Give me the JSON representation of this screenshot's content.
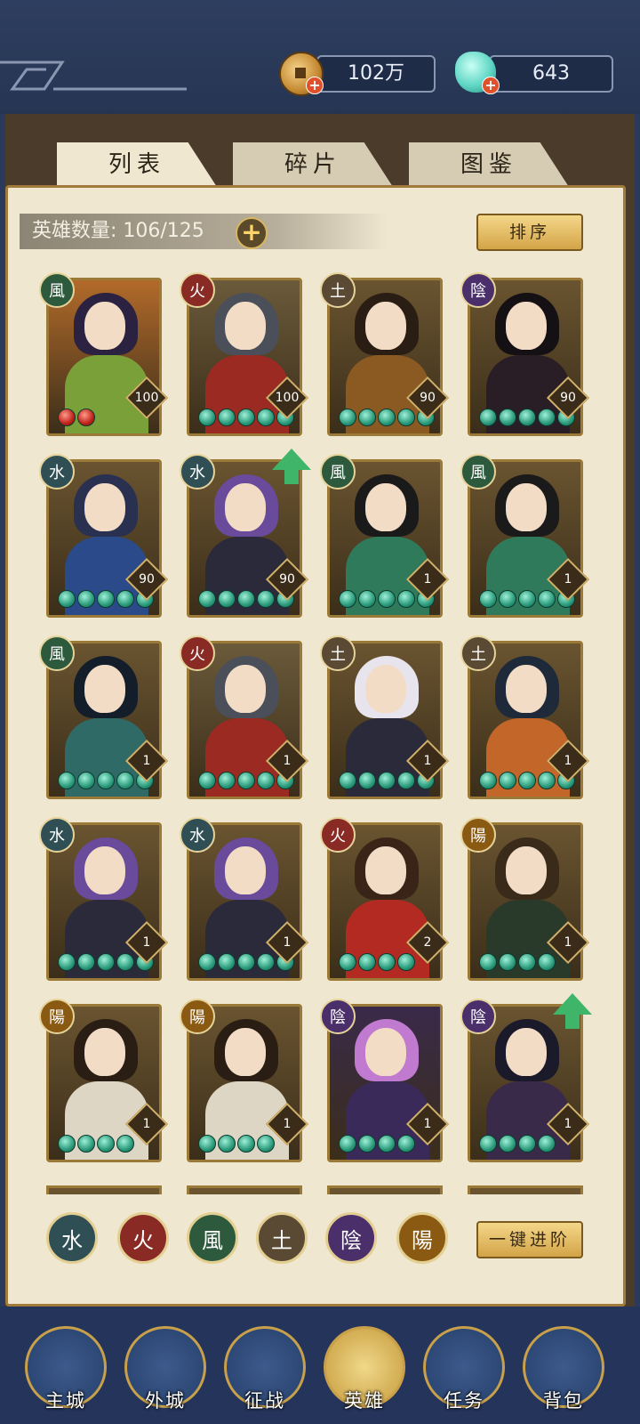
{
  "header": {
    "coins": {
      "value": "102万",
      "icon": "copper-coin-icon"
    },
    "jade": {
      "value": "643",
      "icon": "jade-pouch-icon"
    }
  },
  "tabs": [
    {
      "label": "列表",
      "active": true
    },
    {
      "label": "碎片",
      "active": false
    },
    {
      "label": "图鉴",
      "active": false
    }
  ],
  "hero_count": {
    "label": "英雄数量: 106/125"
  },
  "sort_button": "排序",
  "advance_button": "一键进阶",
  "elements": {
    "water": {
      "glyph": "水",
      "color": "#2f4f55"
    },
    "fire": {
      "glyph": "火",
      "color": "#8a2a24"
    },
    "wind": {
      "glyph": "風",
      "color": "#2d5a3c"
    },
    "earth": {
      "glyph": "土",
      "color": "#5a4a34"
    },
    "yin": {
      "glyph": "陰",
      "color": "#4a2f6a"
    },
    "yang": {
      "glyph": "陽",
      "color": "#8a5a12"
    }
  },
  "heroes": [
    {
      "element": "wind",
      "level": "100",
      "beads": 2,
      "bead_color": "red",
      "bg": "#b26a2a",
      "hair": "#2a2240",
      "body": "#7aa03a",
      "upgrade": false
    },
    {
      "element": "fire",
      "level": "100",
      "beads": 5,
      "bg": "#6b5a3a",
      "hair": "#4a4f5a",
      "body": "#9a2a22",
      "upgrade": false
    },
    {
      "element": "earth",
      "level": "90",
      "beads": 5,
      "bg": "#6a5430",
      "hair": "#2a1e14",
      "body": "#8a5a22",
      "upgrade": false
    },
    {
      "element": "yin",
      "level": "90",
      "beads": 5,
      "bg": "#6a5430",
      "hair": "#141014",
      "body": "#2a1e26",
      "upgrade": false
    },
    {
      "element": "water",
      "level": "90",
      "beads": 5,
      "bg": "#6a5430",
      "hair": "#2a3050",
      "body": "#2a4a8a",
      "upgrade": false
    },
    {
      "element": "water",
      "level": "90",
      "beads": 5,
      "bg": "#6a5430",
      "hair": "#6a4a9a",
      "body": "#2a2a3a",
      "upgrade": true
    },
    {
      "element": "wind",
      "level": "1",
      "beads": 5,
      "bg": "#6a5430",
      "hair": "#1a1a1a",
      "body": "#2f7a5a",
      "upgrade": false
    },
    {
      "element": "wind",
      "level": "1",
      "beads": 5,
      "bg": "#6a5430",
      "hair": "#1a1a1a",
      "body": "#2f7a5a",
      "upgrade": false
    },
    {
      "element": "wind",
      "level": "1",
      "beads": 5,
      "bg": "#6a5430",
      "hair": "#141e2a",
      "body": "#2f6a66",
      "upgrade": false
    },
    {
      "element": "fire",
      "level": "1",
      "beads": 5,
      "bg": "#6b5a3a",
      "hair": "#4a4f5a",
      "body": "#9a2a22",
      "upgrade": false
    },
    {
      "element": "earth",
      "level": "1",
      "beads": 5,
      "bg": "#6a5430",
      "hair": "#e8e4ee",
      "body": "#2a2a3a",
      "upgrade": false
    },
    {
      "element": "earth",
      "level": "1",
      "beads": 5,
      "bg": "#6a5430",
      "hair": "#1e2a3a",
      "body": "#c2662a",
      "upgrade": false
    },
    {
      "element": "water",
      "level": "1",
      "beads": 5,
      "bg": "#6a5430",
      "hair": "#6a4a9a",
      "body": "#2a2a3a",
      "upgrade": false
    },
    {
      "element": "water",
      "level": "1",
      "beads": 5,
      "bg": "#6a5430",
      "hair": "#6a4a9a",
      "body": "#2a2a3a",
      "upgrade": false
    },
    {
      "element": "fire",
      "level": "2",
      "beads": 4,
      "bg": "#6a5430",
      "hair": "#3a2418",
      "body": "#b22a22",
      "upgrade": false
    },
    {
      "element": "yang",
      "level": "1",
      "beads": 4,
      "bg": "#6a5430",
      "hair": "#3a2a1a",
      "body": "#2a3a2a",
      "upgrade": false
    },
    {
      "element": "yang",
      "level": "1",
      "beads": 4,
      "bg": "#6a5430",
      "hair": "#2a1e14",
      "body": "#ddd6c4",
      "upgrade": false
    },
    {
      "element": "yang",
      "level": "1",
      "beads": 4,
      "bg": "#6a5430",
      "hair": "#2a1e14",
      "body": "#ddd6c4",
      "upgrade": false
    },
    {
      "element": "yin",
      "level": "1",
      "beads": 4,
      "bg": "#3a2a4a",
      "hair": "#c07ad0",
      "body": "#3a2a5a",
      "upgrade": false
    },
    {
      "element": "yin",
      "level": "1",
      "beads": 4,
      "bg": "#6a5430",
      "hair": "#1a1a2a",
      "body": "#3a2a4a",
      "upgrade": true
    }
  ],
  "filters": [
    "water",
    "fire",
    "wind",
    "earth",
    "yin",
    "yang"
  ],
  "nav": [
    {
      "label": "主城",
      "icon": "main-city-icon",
      "active": false
    },
    {
      "label": "外城",
      "icon": "outer-city-icon",
      "active": false
    },
    {
      "label": "征战",
      "icon": "battle-scroll-icon",
      "active": false
    },
    {
      "label": "英雄",
      "icon": "hero-icon",
      "active": true
    },
    {
      "label": "任务",
      "icon": "task-scroll-icon",
      "active": false
    },
    {
      "label": "背包",
      "icon": "bag-icon",
      "active": false
    }
  ]
}
